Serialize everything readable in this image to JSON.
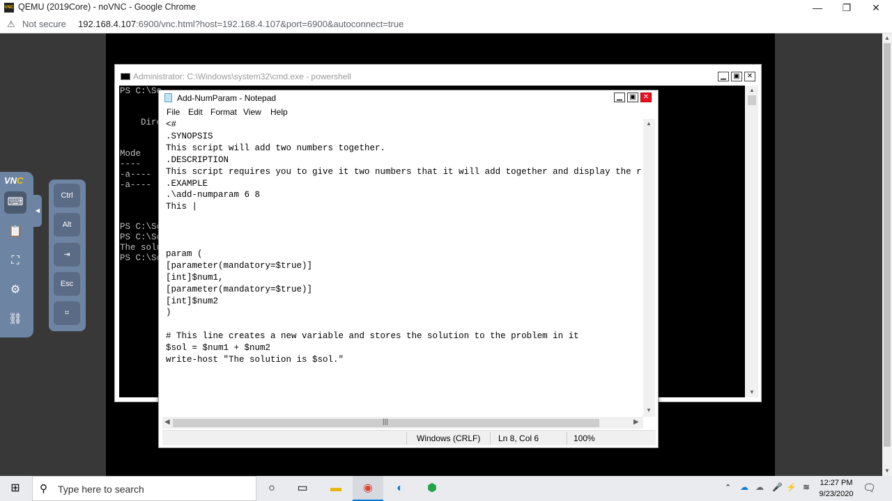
{
  "browser": {
    "title": "QEMU (2019Core) - noVNC - Google Chrome",
    "favicon_text": "VNC",
    "security_text": "Not secure",
    "url_host": "192.168.4.107",
    "url_rest": ":6900/vnc.html?host=192.168.4.107&port=6900&autoconnect=true",
    "min_glyph": "—",
    "max_glyph": "❐",
    "close_glyph": "✕"
  },
  "console": {
    "title": "Administrator: C:\\Windows\\system32\\cmd.exe - powershell",
    "lines": [
      "PS C:\\Sc",
      "",
      "",
      "    Dire",
      "",
      "",
      "Mode",
      "----",
      "-a----",
      "-a----",
      "",
      "",
      "",
      "PS C:\\Sc",
      "PS C:\\Sc",
      "The solu",
      "PS C:\\Sc"
    ]
  },
  "notepad": {
    "title": "Add-NumParam - Notepad",
    "menu": [
      "File",
      "Edit",
      "Format",
      "View",
      "Help"
    ],
    "lines": [
      "<#",
      ".SYNOPSIS",
      "This script will add two numbers together.",
      ".DESCRIPTION",
      "This script requires you to give it two numbers that it will add together and display the r",
      ".EXAMPLE",
      ".\\add-numparam 6 8",
      "This |",
      "",
      "",
      "",
      "param (",
      "[parameter(mandatory=$true)]",
      "[int]$num1,",
      "[parameter(mandatory=$true)]",
      "[int]$num2",
      ")",
      "",
      "# This line creates a new variable and stores the solution to the problem in it",
      "$sol = $num1 + $num2",
      "write-host \"The solution is $sol.\""
    ],
    "status": {
      "line_ending": "Windows (CRLF)",
      "position": "Ln 8, Col 6",
      "zoom": "100%"
    }
  },
  "novnc": {
    "logo_v": "V",
    "logo_n": "N",
    "logo_c": "C",
    "extra_keys": [
      "Ctrl",
      "Alt",
      "⇥",
      "Esc",
      "⌗"
    ]
  },
  "taskbar": {
    "search_placeholder": "Type here to search",
    "time": "12:27 PM",
    "date": "9/23/2020"
  }
}
